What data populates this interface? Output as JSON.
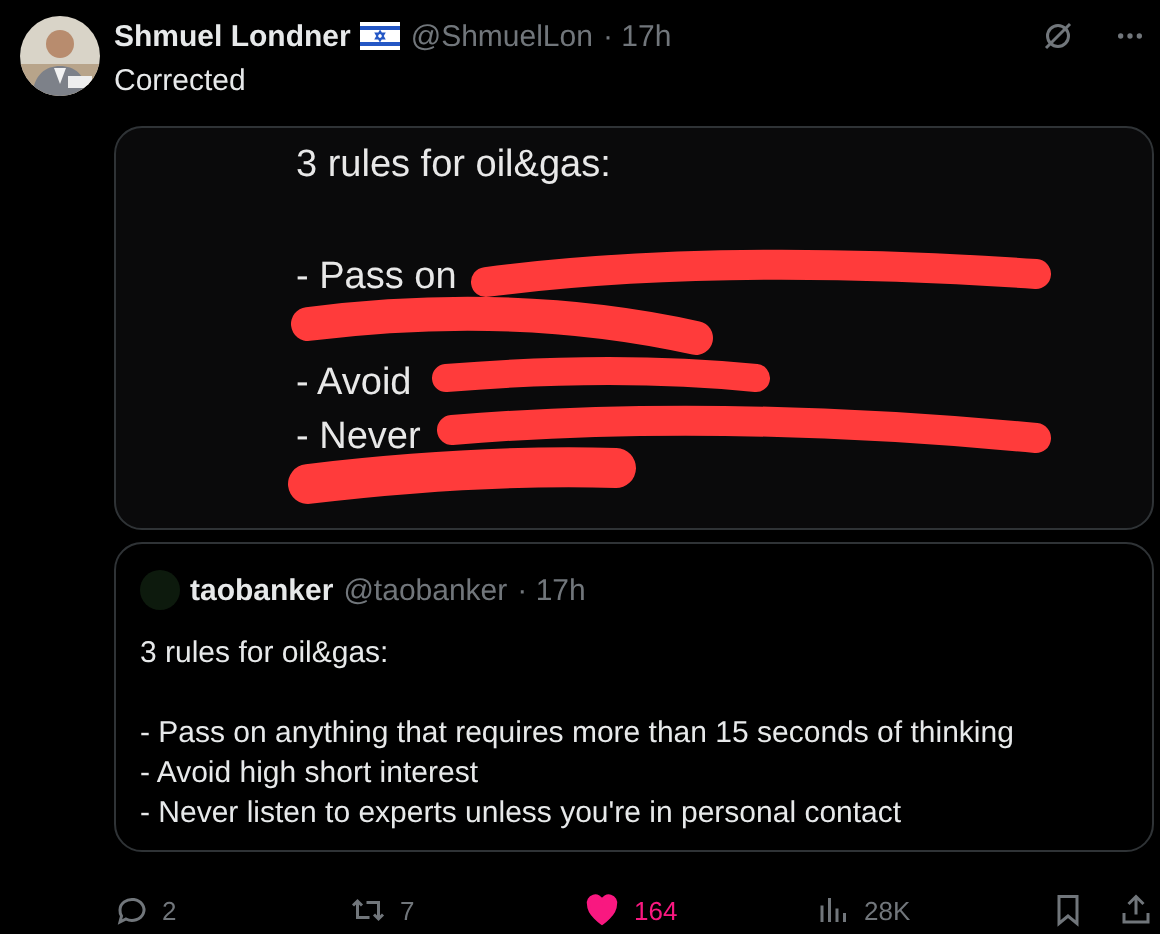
{
  "post": {
    "author": "Shmuel Londner",
    "handle": "@ShmuelLon",
    "time": "· 17h",
    "text": "Corrected",
    "image": {
      "lines": [
        "3 rules for oil&gas:",
        "- Pass on",
        "- Avoid",
        "- Never"
      ]
    },
    "quote": {
      "author": "taobanker",
      "handle": "@taobanker",
      "time": "· 17h",
      "title": "3 rules for oil&gas:",
      "lines": [
        "- Pass on anything that requires more than 15 seconds of thinking",
        "- Avoid high short interest",
        "- Never listen to experts unless you're in personal contact"
      ]
    },
    "actions": [
      {
        "kind": "reply",
        "count": "2"
      },
      {
        "kind": "repost",
        "count": "7"
      },
      {
        "kind": "like",
        "count": "164",
        "liked": true
      },
      {
        "kind": "views",
        "count": "28K"
      },
      {
        "kind": "bookmark"
      },
      {
        "kind": "share"
      }
    ]
  }
}
